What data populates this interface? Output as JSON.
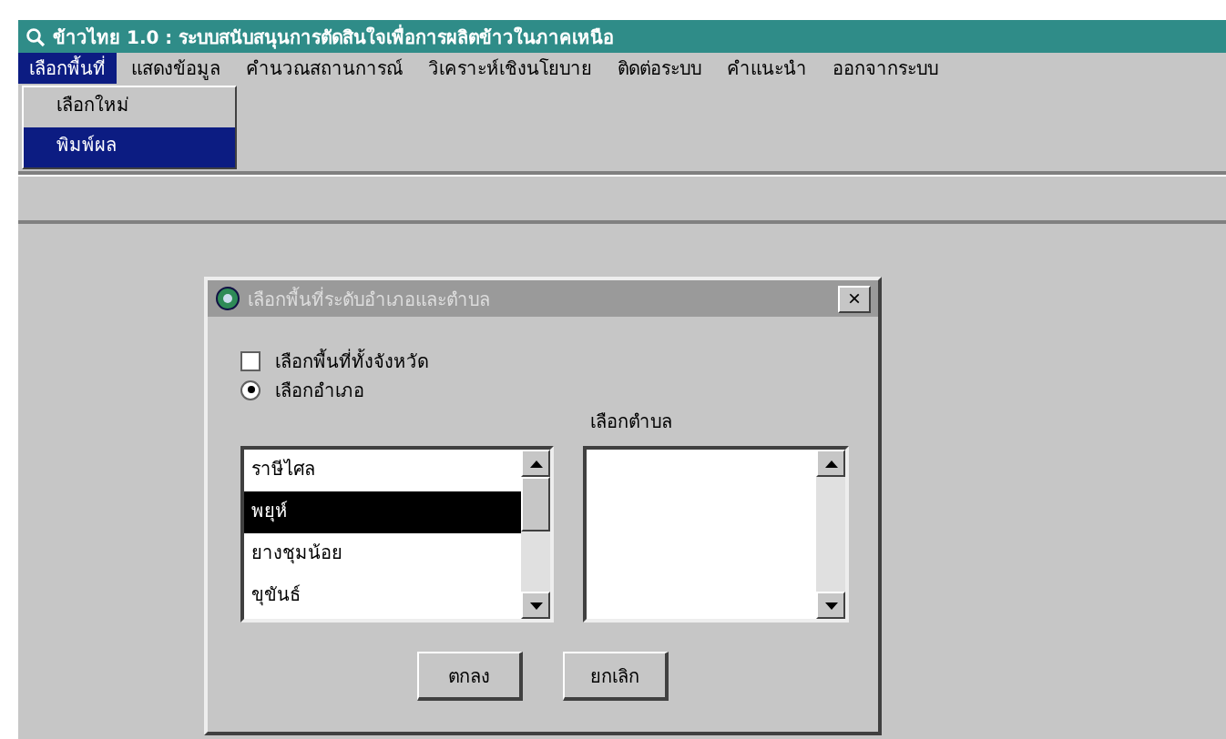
{
  "window": {
    "title": "ข้าวไทย 1.0 : ระบบสนับสนุนการตัดสินใจเพื่อการผลิตข้าวในภาคเหนือ"
  },
  "menu": [
    {
      "label": "เลือกพื้นที่",
      "selected": true
    },
    {
      "label": "แสดงข้อมูล",
      "selected": false
    },
    {
      "label": "คำนวณสถานการณ์",
      "selected": false
    },
    {
      "label": "วิเคราะห์เชิงนโยบาย",
      "selected": false
    },
    {
      "label": "ติดต่อระบบ",
      "selected": false
    },
    {
      "label": "คำแนะนำ",
      "selected": false
    },
    {
      "label": "ออกจากระบบ",
      "selected": false
    }
  ],
  "dropdown": [
    {
      "label": "เลือกใหม่",
      "selected": false
    },
    {
      "label": "พิมพ์ผล",
      "selected": true
    }
  ],
  "dialog": {
    "title": "เลือกพื้นที่ระดับอำเภอและตำบล",
    "close": "×",
    "options": [
      {
        "label": "เลือกพื้นที่ทั้งจังหวัด",
        "kind": "checkbox",
        "checked": false
      },
      {
        "label": "เลือกอำเภอ",
        "kind": "radio",
        "checked": true
      }
    ],
    "district_list": [
      {
        "label": "ราษีไศล",
        "selected": false
      },
      {
        "label": "พยุห์",
        "selected": true
      },
      {
        "label": "ยางชุมน้อย",
        "selected": false
      },
      {
        "label": "ขุขันธ์",
        "selected": false
      }
    ],
    "subdistrict_label": "เลือกตำบล",
    "buttons": [
      "ตกลง",
      "ยกเลิก"
    ]
  }
}
